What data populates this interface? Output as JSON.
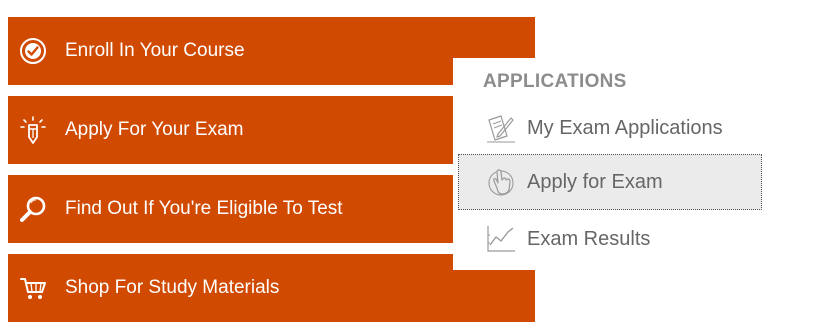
{
  "theme": {
    "accent": "#d04a02",
    "text_light": "#ffffff",
    "menu_text": "#666666",
    "heading": "#8c8c8c"
  },
  "buttons": [
    {
      "label": "Enroll In Your Course",
      "icon": "check-circle-icon"
    },
    {
      "label": "Apply For Your Exam",
      "icon": "pencil-icon"
    },
    {
      "label": "Find Out If You're Eligible To Test",
      "icon": "magnifier-icon"
    },
    {
      "label": "Shop For Study Materials",
      "icon": "cart-icon"
    }
  ],
  "applications_menu": {
    "title": "APPLICATIONS",
    "items": [
      {
        "label": "My Exam Applications",
        "icon": "document-pen-icon",
        "selected": false
      },
      {
        "label": "Apply for Exam",
        "icon": "hand-pointer-icon",
        "selected": true
      },
      {
        "label": "Exam Results",
        "icon": "line-chart-icon",
        "selected": false
      }
    ]
  }
}
